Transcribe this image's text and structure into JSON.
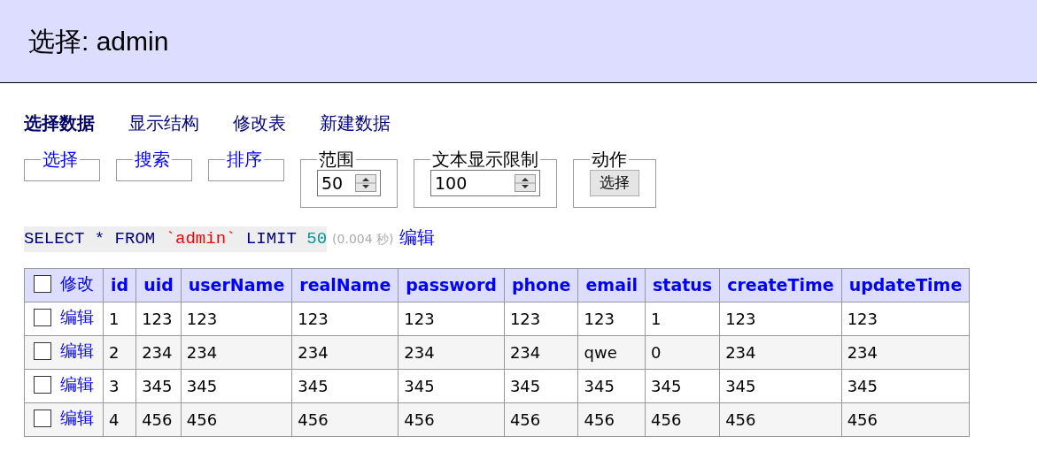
{
  "header": {
    "title": "选择: admin"
  },
  "nav": [
    {
      "label": "选择数据",
      "selected": true
    },
    {
      "label": "显示结构",
      "selected": false
    },
    {
      "label": "修改表",
      "selected": false
    },
    {
      "label": "新建数据",
      "selected": false
    }
  ],
  "fieldsets": [
    {
      "legend": "选择",
      "kind": "link"
    },
    {
      "legend": "搜索",
      "kind": "link"
    },
    {
      "legend": "排序",
      "kind": "link"
    },
    {
      "legend": "范围",
      "kind": "number",
      "value": "50"
    },
    {
      "legend": "文本显示限制",
      "kind": "number",
      "value": "100"
    },
    {
      "legend": "动作",
      "kind": "button",
      "button": "选择"
    }
  ],
  "query": {
    "parts": [
      {
        "kind": "keyword",
        "text": "SELECT * FROM "
      },
      {
        "kind": "identifier",
        "text": "`admin`"
      },
      {
        "kind": "keyword",
        "text": " LIMIT "
      },
      {
        "kind": "number",
        "text": "50"
      }
    ],
    "time": "(0.004 秒)",
    "edit_link": "编辑"
  },
  "table": {
    "select_all": {
      "checked": false
    },
    "edit_header": "修改",
    "columns": [
      "id",
      "uid",
      "userName",
      "realName",
      "password",
      "phone",
      "email",
      "status",
      "createTime",
      "updateTime"
    ],
    "rows": [
      {
        "checked": false,
        "edit": "编辑",
        "cells": [
          "1",
          "123",
          "123",
          "123",
          "123",
          "123",
          "123",
          "1",
          "123",
          "123"
        ]
      },
      {
        "checked": false,
        "edit": "编辑",
        "cells": [
          "2",
          "234",
          "234",
          "234",
          "234",
          "234",
          "qwe",
          "0",
          "234",
          "234"
        ]
      },
      {
        "checked": false,
        "edit": "编辑",
        "cells": [
          "3",
          "345",
          "345",
          "345",
          "345",
          "345",
          "345",
          "345",
          "345",
          "345"
        ]
      },
      {
        "checked": false,
        "edit": "编辑",
        "cells": [
          "4",
          "456",
          "456",
          "456",
          "456",
          "456",
          "456",
          "456",
          "456",
          "456"
        ]
      }
    ]
  }
}
